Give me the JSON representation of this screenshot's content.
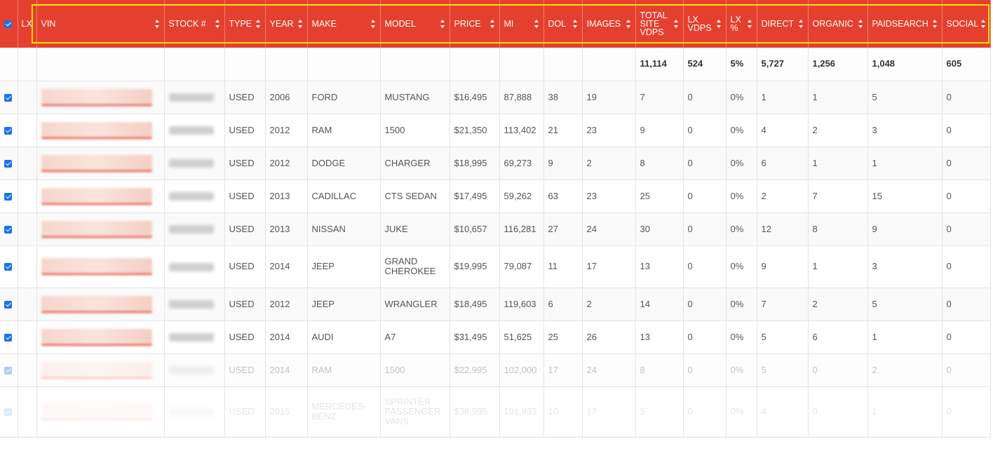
{
  "columns": [
    {
      "key": "cb",
      "label": ""
    },
    {
      "key": "lx",
      "label": "LX"
    },
    {
      "key": "vin",
      "label": "VIN"
    },
    {
      "key": "stock",
      "label": "STOCK #"
    },
    {
      "key": "type",
      "label": "TYPE"
    },
    {
      "key": "year",
      "label": "YEAR"
    },
    {
      "key": "make",
      "label": "MAKE"
    },
    {
      "key": "model",
      "label": "MODEL"
    },
    {
      "key": "price",
      "label": "PRICE"
    },
    {
      "key": "mi",
      "label": "MI"
    },
    {
      "key": "dol",
      "label": "DOL"
    },
    {
      "key": "images",
      "label": "IMAGES"
    },
    {
      "key": "total",
      "label": "TOTAL SITE VDPS"
    },
    {
      "key": "lxvdps",
      "label": "LX VDPS"
    },
    {
      "key": "lxpct",
      "label": "LX %"
    },
    {
      "key": "direct",
      "label": "DIRECT"
    },
    {
      "key": "organic",
      "label": "ORGANIC"
    },
    {
      "key": "paid",
      "label": "PAIDSEARCH"
    },
    {
      "key": "social",
      "label": "SOCIAL"
    }
  ],
  "totals": {
    "total": "11,114",
    "lxvdps": "524",
    "lxpct": "5%",
    "direct": "5,727",
    "organic": "1,256",
    "paid": "1,048",
    "social": "605"
  },
  "rows": [
    {
      "type": "USED",
      "year": "2006",
      "make": "FORD",
      "model": "MUSTANG",
      "price": "$16,495",
      "mi": "87,888",
      "dol": "38",
      "images": "19",
      "total": "7",
      "lxvdps": "0",
      "lxpct": "0%",
      "direct": "1",
      "organic": "1",
      "paid": "5",
      "social": "0"
    },
    {
      "type": "USED",
      "year": "2012",
      "make": "RAM",
      "model": "1500",
      "price": "$21,350",
      "mi": "113,402",
      "dol": "21",
      "images": "23",
      "total": "9",
      "lxvdps": "0",
      "lxpct": "0%",
      "direct": "4",
      "organic": "2",
      "paid": "3",
      "social": "0"
    },
    {
      "type": "USED",
      "year": "2012",
      "make": "DODGE",
      "model": "CHARGER",
      "price": "$18,995",
      "mi": "69,273",
      "dol": "9",
      "images": "2",
      "total": "8",
      "lxvdps": "0",
      "lxpct": "0%",
      "direct": "6",
      "organic": "1",
      "paid": "1",
      "social": "0"
    },
    {
      "type": "USED",
      "year": "2013",
      "make": "CADILLAC",
      "model": "CTS SEDAN",
      "price": "$17,495",
      "mi": "59,262",
      "dol": "63",
      "images": "23",
      "total": "25",
      "lxvdps": "0",
      "lxpct": "0%",
      "direct": "2",
      "organic": "7",
      "paid": "15",
      "social": "0"
    },
    {
      "type": "USED",
      "year": "2013",
      "make": "NISSAN",
      "model": "JUKE",
      "price": "$10,657",
      "mi": "116,281",
      "dol": "27",
      "images": "24",
      "total": "30",
      "lxvdps": "0",
      "lxpct": "0%",
      "direct": "12",
      "organic": "8",
      "paid": "9",
      "social": "0"
    },
    {
      "type": "USED",
      "year": "2014",
      "make": "JEEP",
      "model": "GRAND CHEROKEE",
      "price": "$19,995",
      "mi": "79,087",
      "dol": "11",
      "images": "17",
      "total": "13",
      "lxvdps": "0",
      "lxpct": "0%",
      "direct": "9",
      "organic": "1",
      "paid": "3",
      "social": "0"
    },
    {
      "type": "USED",
      "year": "2012",
      "make": "JEEP",
      "model": "WRANGLER",
      "price": "$18,495",
      "mi": "119,603",
      "dol": "6",
      "images": "2",
      "total": "14",
      "lxvdps": "0",
      "lxpct": "0%",
      "direct": "7",
      "organic": "2",
      "paid": "5",
      "social": "0"
    },
    {
      "type": "USED",
      "year": "2014",
      "make": "AUDI",
      "model": "A7",
      "price": "$31,495",
      "mi": "51,625",
      "dol": "25",
      "images": "26",
      "total": "13",
      "lxvdps": "0",
      "lxpct": "0%",
      "direct": "5",
      "organic": "6",
      "paid": "1",
      "social": "0"
    },
    {
      "type": "USED",
      "year": "2014",
      "make": "RAM",
      "model": "1500",
      "price": "$22,995",
      "mi": "102,000",
      "dol": "17",
      "images": "24",
      "total": "8",
      "lxvdps": "0",
      "lxpct": "0%",
      "direct": "5",
      "organic": "0",
      "paid": "2",
      "social": "0"
    },
    {
      "type": "USED",
      "year": "2015",
      "make": "MERCEDES-BENZ",
      "model": "SPRINTER PASSENGER VANS",
      "price": "$38,995",
      "mi": "101,933",
      "dol": "10",
      "images": "17",
      "total": "5",
      "lxvdps": "0",
      "lxpct": "0%",
      "direct": "4",
      "organic": "0",
      "paid": "1",
      "social": "0"
    }
  ],
  "colors": {
    "header_bg": "#e5402f",
    "highlight": "#f4e000",
    "checkbox": "#1a73e8"
  }
}
